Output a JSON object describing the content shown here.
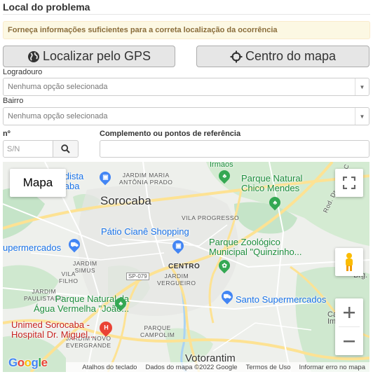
{
  "section": {
    "title": "Local do problema",
    "alert": "Forneça informações suficientes para a correta localização da ocorrência"
  },
  "buttons": {
    "gps_label": "Localizar pelo GPS",
    "center_label": "Centro do mapa"
  },
  "form": {
    "logradouro_label": "Logradouro",
    "logradouro_value": "Nenhuma opção selecionada",
    "bairro_label": "Bairro",
    "bairro_value": "Nenhuma opção selecionada",
    "numero_label": "nº",
    "numero_placeholder": "S/N",
    "complemento_label": "Complemento ou pontos de referência",
    "complemento_value": ""
  },
  "map": {
    "map_type_label": "Mapa",
    "city_labels": [
      "Sorocaba",
      "Votorantim"
    ],
    "pois": {
      "cadastra": "cadista\nocaba",
      "parque_chico": "Parque Natural\nChico Mendes",
      "irmaos": "Irmãos",
      "patio_ciane": "Pátio Cianê Shopping",
      "zoologico": "Parque Zoológico\nMunicipal \"Quinzinho...",
      "supermercados": "upermercados",
      "santo_super": "Santo Supermercados",
      "agua_vermelha": "Parque Natural da\nÁgua Vermelha \"João...",
      "unimed": "Unimed Sorocaba -\nHospital Dr. Miguel..."
    },
    "neighborhoods": {
      "jardim_maria": "JARDIM MARIA\nANTÔNIA PRADO",
      "vila_progresso": "VILA PROGRESSO",
      "centro": "CENTRO",
      "jardim_vergueiro": "JARDIM\nVERGUEIRO",
      "jardim_simus": "JARDIM\nSIMUS",
      "jardim_paulistano": "JARDIM\nPAULISTANO",
      "vila_fiho": "VILA\nFILHO",
      "parque_campolim": "PARQUE\nCAMPOLIM",
      "jardim_novo": "JARDIM NOVO\nEVERGRANDE"
    },
    "road_labels": {
      "sp079": "SP-079",
      "celso": "Rod. Dr. Celso C",
      "brg": "Brg. Tob",
      "capela": "Capela\nImac"
    },
    "attribution": {
      "shortcuts": "Atalhos do teclado",
      "map_data": "Dados do mapa ©2022 Google",
      "terms": "Termos de Uso",
      "report": "Informar erro no mapa"
    },
    "logo": "Google"
  },
  "colors": {
    "alert_bg": "#fcf8e3",
    "alert_text": "#8a6d3b",
    "button_bg": "#e6e6e6",
    "park_green": "#c8e6c9",
    "road_yellow": "#fde293"
  }
}
